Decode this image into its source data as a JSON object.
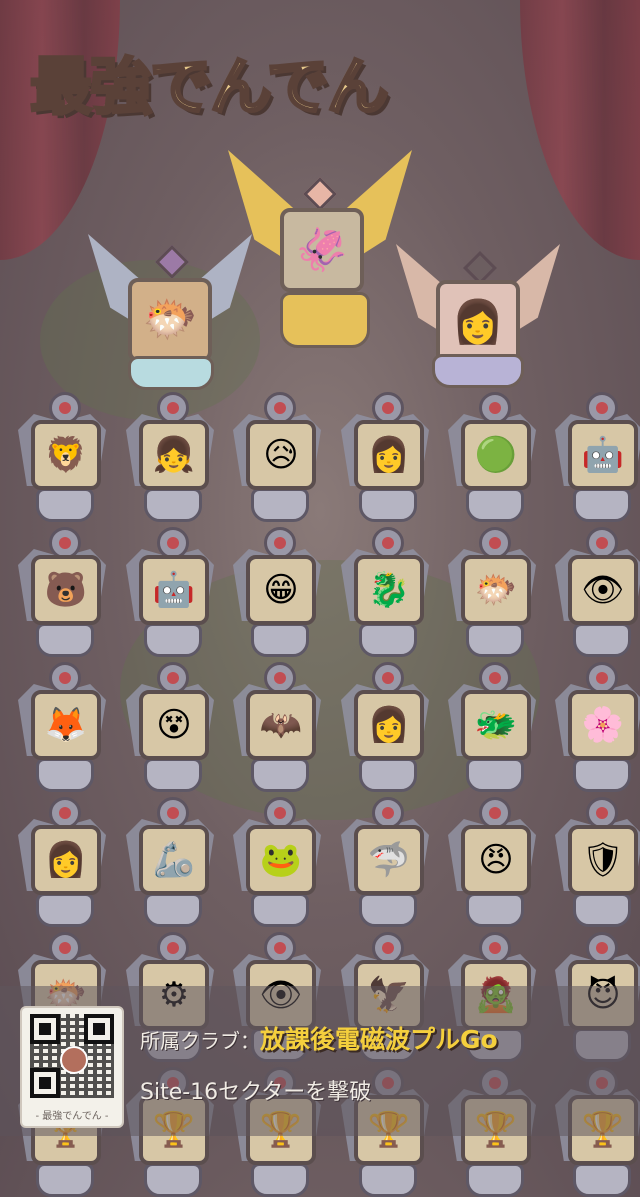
{
  "logo": {
    "title": "最強でんでん"
  },
  "podium": {
    "first": {
      "icon": "shadow-creature-icon",
      "glyph": "🦑",
      "color": "#e6c15a"
    },
    "second": {
      "icon": "orange-blob-icon",
      "glyph": "🐡",
      "color": "#b9bcc9"
    },
    "third": {
      "icon": "pink-hair-girl-icon",
      "glyph": "👩",
      "color": "#d8b8a8"
    }
  },
  "grid": {
    "rows": [
      [
        {
          "icon": "armored-knight-icon",
          "glyph": "🦁"
        },
        {
          "icon": "green-hair-girl-icon",
          "glyph": "👧"
        },
        {
          "icon": "blonde-girl-icon",
          "glyph": "😥"
        },
        {
          "icon": "pink-woman-icon",
          "glyph": "👩"
        },
        {
          "icon": "green-slime-icon",
          "glyph": "🟢"
        },
        {
          "icon": "silver-robot-eye-icon",
          "glyph": "🤖"
        }
      ],
      [
        {
          "icon": "bear-sunglasses-icon",
          "glyph": "🐻"
        },
        {
          "icon": "grey-robot-icon",
          "glyph": "🤖"
        },
        {
          "icon": "brown-hair-boy-icon",
          "glyph": "😁"
        },
        {
          "icon": "yellow-dragon-icon",
          "glyph": "🐉"
        },
        {
          "icon": "orange-blob-icon",
          "glyph": "🐡"
        },
        {
          "icon": "dark-creature-icon",
          "glyph": "👁"
        }
      ],
      [
        {
          "icon": "orange-fox-icon",
          "glyph": "🦊"
        },
        {
          "icon": "blue-ghost-icon",
          "glyph": "😵"
        },
        {
          "icon": "shadow-figure-icon",
          "glyph": "🦇"
        },
        {
          "icon": "black-hair-girl-icon",
          "glyph": "👩"
        },
        {
          "icon": "blue-hydra-icon",
          "glyph": "🐲"
        },
        {
          "icon": "red-flower-girl-icon",
          "glyph": "🌸"
        }
      ],
      [
        {
          "icon": "red-hair-girl-icon",
          "glyph": "👩"
        },
        {
          "icon": "mecha-robot-icon",
          "glyph": "🦾"
        },
        {
          "icon": "green-frog-icon",
          "glyph": "🐸"
        },
        {
          "icon": "blue-shark-icon",
          "glyph": "🦈"
        },
        {
          "icon": "blonde-boy-icon",
          "glyph": "😠"
        },
        {
          "icon": "blue-tank-icon",
          "glyph": "🛡"
        }
      ],
      [
        {
          "icon": "orange-blob-icon",
          "glyph": "🐡"
        },
        {
          "icon": "pokeball-icon",
          "glyph": "⚙"
        },
        {
          "icon": "pink-eyeball-icon",
          "glyph": "👁"
        },
        {
          "icon": "dark-bird-icon",
          "glyph": "🦅"
        },
        {
          "icon": "zombie-man-icon",
          "glyph": "🧟"
        },
        {
          "icon": "black-blob-icon",
          "glyph": "😈"
        }
      ],
      [
        {
          "icon": "partial-trophy-icon",
          "glyph": "🏆"
        },
        {
          "icon": "partial-trophy-icon",
          "glyph": "🏆"
        },
        {
          "icon": "partial-trophy-icon",
          "glyph": "🏆"
        },
        {
          "icon": "partial-trophy-icon",
          "glyph": "🏆"
        },
        {
          "icon": "partial-trophy-icon",
          "glyph": "🏆"
        },
        {
          "icon": "partial-trophy-icon",
          "glyph": "🏆"
        }
      ]
    ]
  },
  "info": {
    "qr_caption": "- 最強でんでん -",
    "club_label": "所属クラブ：",
    "club_name": "放課後電磁波プルGo",
    "achievement": "Site-16セクターを撃破"
  }
}
